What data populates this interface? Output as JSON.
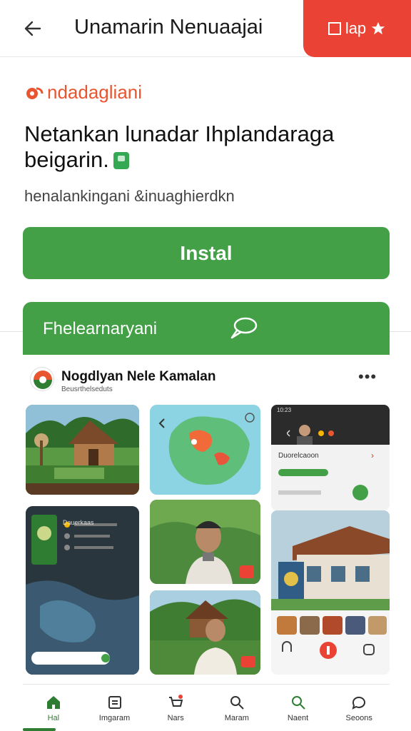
{
  "topbar": {
    "title": "Unamarin Nenuaajai",
    "action_label": "lap"
  },
  "app": {
    "brand_name": "ndadagliani",
    "headline": "Netankan lunadar  Ihplandaraga beigarin.",
    "subtext": "henalankingani &inuaghierdkn",
    "install_label": "Instal"
  },
  "promo": {
    "label": "Fhelearnaryani"
  },
  "card": {
    "title": "Nogdlyan Nele Kamalan",
    "subtitle": "Beusrthelseduts",
    "more": "•••"
  },
  "screens": {
    "phone_top_status": "10:23",
    "phone_top_name": "Duorelcaoon",
    "dark_panel_title": "Dauerkaas"
  },
  "bottom_nav": {
    "items": [
      {
        "label": "Hal",
        "icon": "home-icon"
      },
      {
        "label": "Imgaram",
        "icon": "list-icon"
      },
      {
        "label": "Nars",
        "icon": "cart-icon"
      },
      {
        "label": "Maram",
        "icon": "search-icon"
      },
      {
        "label": "Naent",
        "icon": "search-icon"
      },
      {
        "label": "Seoons",
        "icon": "chat-icon"
      }
    ]
  },
  "colors": {
    "accent_green": "#43a047",
    "accent_red": "#ea4335",
    "brand_orange": "#e8552f"
  }
}
